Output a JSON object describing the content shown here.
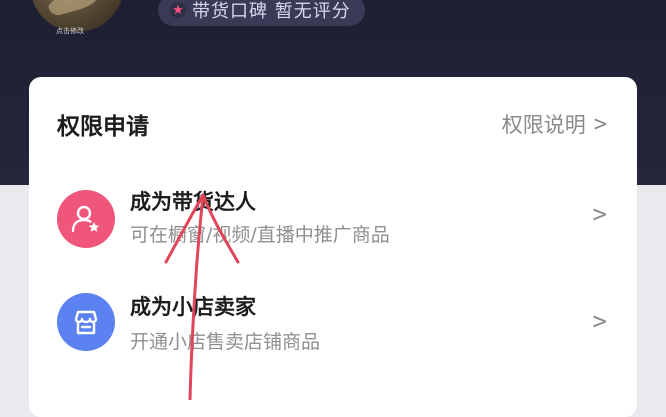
{
  "profile": {
    "avatar_caption": "点击修改",
    "rating_text": "带货口碑 暂无评分"
  },
  "permissions": {
    "title": "权限申请",
    "explain_label": "权限说明",
    "items": [
      {
        "title": "成为带货达人",
        "subtitle": "可在橱窗/视频/直播中推广商品",
        "icon": "user-star-icon",
        "icon_color": "#f0557a"
      },
      {
        "title": "成为小店卖家",
        "subtitle": "开通小店售卖店铺商品",
        "icon": "store-icon",
        "icon_color": "#5b82f0"
      }
    ]
  },
  "colors": {
    "header_bg": "#1f1f33",
    "annotation_arrow": "#e0455a"
  }
}
